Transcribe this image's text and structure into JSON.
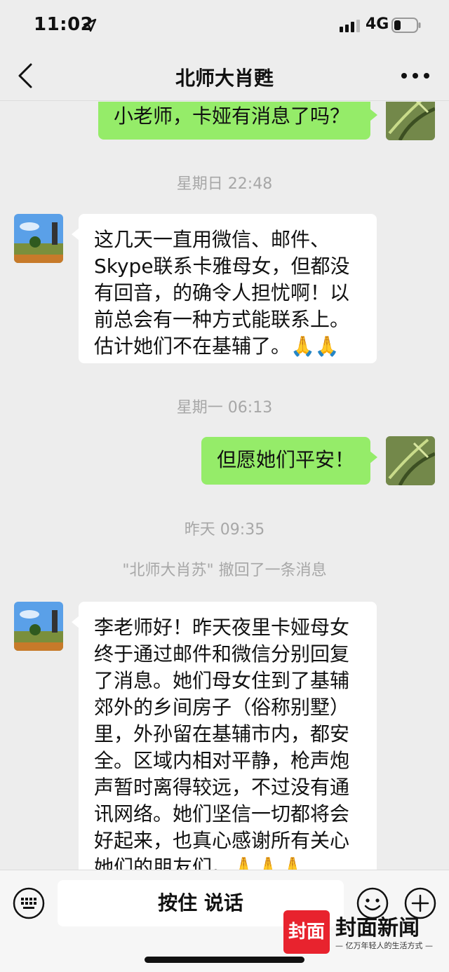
{
  "status_bar": {
    "time": "11:02",
    "network": "4G",
    "icons": [
      "location-arrow-icon",
      "signal-icon",
      "battery-icon"
    ]
  },
  "nav": {
    "title": "北师大肖甦",
    "icons": [
      "back-chevron-icon",
      "more-dots-icon"
    ]
  },
  "messages": [
    {
      "type": "outgoing",
      "lines": [
        "小老师，卡娅有消息了吗？"
      ]
    },
    {
      "type": "time",
      "text": "星期日 22:48"
    },
    {
      "type": "incoming",
      "lines": [
        "这几天一直用微信、邮件、",
        "Skype联系卡雅母女，但都没",
        "有回音，的确令人担忧啊！以",
        "前总会有一种方式能联系上。",
        "估计她们不在基辅了。🙏🙏"
      ]
    },
    {
      "type": "time",
      "text": "星期一 06:13"
    },
    {
      "type": "outgoing",
      "lines": [
        "但愿她们平安！"
      ]
    },
    {
      "type": "time",
      "text": "昨天 09:35"
    },
    {
      "type": "system",
      "text": "\"北师大肖苏\" 撤回了一条消息"
    },
    {
      "type": "incoming",
      "lines": [
        "李老师好！昨天夜里卡娅母女",
        "终于通过邮件和微信分别回复",
        "了消息。她们母女住到了基辅",
        "郊外的乡间房子（俗称别墅）",
        "里，外孙留在基辅市内，都安",
        "全。区域内相对平静，枪声炮",
        "声暂时离得较远，不过没有通",
        "讯网络。她们坚信一切都将会",
        "好起来，也真心感谢所有关心",
        "她们的朋友们。🙏🙏🙏"
      ]
    }
  ],
  "input_bar": {
    "voice_label": "按住 说话",
    "icons": [
      "keyboard-icon",
      "emoji-icon",
      "plus-icon"
    ]
  },
  "watermark": {
    "badge": "封面",
    "title": "封面新闻",
    "slogan": "— 亿万年轻人的生活方式 —"
  },
  "colors": {
    "background": "#ededed",
    "outgoing_bubble": "#95ec69",
    "incoming_bubble": "#ffffff",
    "timestamp_text": "#a7a7a7",
    "watermark_red": "#e8232e"
  }
}
